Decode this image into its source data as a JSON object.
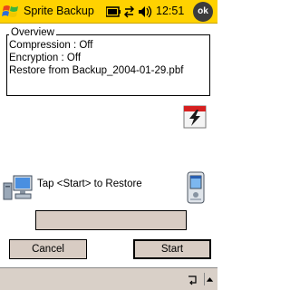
{
  "title_bar": {
    "app_title": "Sprite Backup",
    "time": "12:51",
    "ok_label": "ok"
  },
  "overview": {
    "legend": "Overview",
    "compression": "Compression : Off",
    "encryption": "Encryption : Off",
    "restore_from": "Restore from Backup_2004-01-29.pbf"
  },
  "main": {
    "instruction": "Tap <Start> to Restore",
    "progress_fraction": 0
  },
  "buttons": {
    "cancel_label": "Cancel",
    "start_label": "Start"
  },
  "colors": {
    "title_bar": "#ffd200",
    "button_face": "#d8ccc3",
    "menu_bar": "#d9d0c8"
  }
}
